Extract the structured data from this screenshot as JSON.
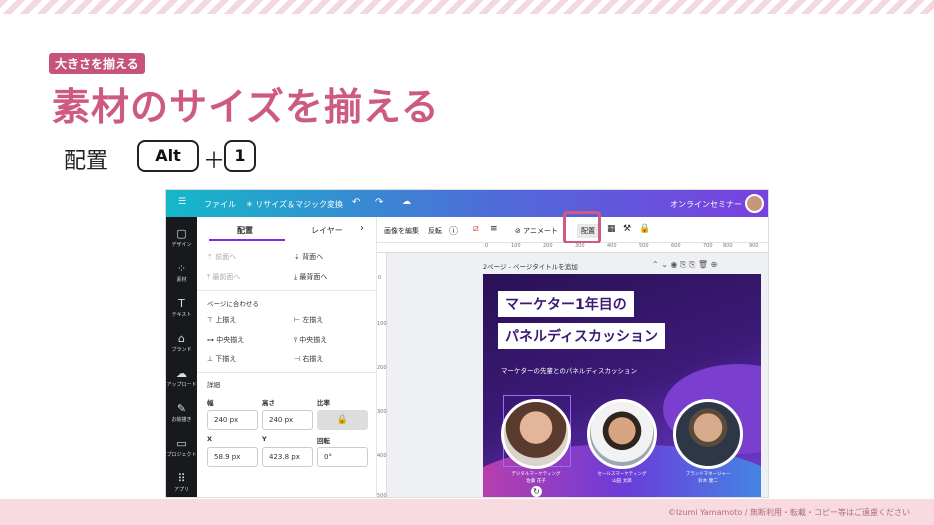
{
  "header": {
    "tag": "大きさを揃える",
    "title": "素材のサイズを揃える",
    "shortcut_label": "配置",
    "key1": "Alt",
    "plus": "＋",
    "key2": "1"
  },
  "footer": {
    "copyright": "©Izumi Yamamoto / 無断利用・転載・コピー等はご遠慮ください"
  },
  "app": {
    "topbar": {
      "menu_icon": "☰",
      "file": "ファイル",
      "resize": "✳ リサイズ＆マジック変換",
      "project_name": "オンラインセミナー"
    },
    "sidebar": [
      {
        "icon": "▢",
        "label": "デザイン"
      },
      {
        "icon": "⁘",
        "label": "素材"
      },
      {
        "icon": "T",
        "label": "テキスト"
      },
      {
        "icon": "⌂",
        "label": "ブランド"
      },
      {
        "icon": "☁",
        "label": "アップロード"
      },
      {
        "icon": "✎",
        "label": "お絵描き"
      },
      {
        "icon": "▭",
        "label": "プロジェクト"
      },
      {
        "icon": "⠿",
        "label": "アプリ"
      }
    ],
    "panel": {
      "tab_arrange": "配置",
      "tab_layer": "レイヤー",
      "tab_next": "›",
      "order": {
        "forward": "前面へ",
        "backward": "背面へ",
        "front": "最前面へ",
        "back": "最背面へ"
      },
      "align_title": "ページに合わせる",
      "align": {
        "top": "上揃え",
        "left": "左揃え",
        "middle": "中央揃え",
        "center": "中央揃え",
        "bottom": "下揃え",
        "right": "右揃え"
      },
      "detail_title": "詳細",
      "width_label": "幅",
      "height_label": "高さ",
      "ratio_label": "比率",
      "width": "240 px",
      "height": "240 px",
      "lock_icon": "🔒",
      "x_label": "X",
      "y_label": "Y",
      "rot_label": "回転",
      "x": "58.9 px",
      "y": "423.8 px",
      "rotation": "0°"
    },
    "toolbar": {
      "edit_image": "画像を編集",
      "flip": "反転",
      "animate": "アニメート",
      "arrange": "配置"
    },
    "ruler": [
      "0",
      "100",
      "200",
      "300",
      "400",
      "500",
      "600",
      "700",
      "800",
      "900"
    ],
    "vruler": [
      "0",
      "100",
      "200",
      "300",
      "400",
      "500"
    ],
    "page_label": "2ページ - ページタイトルを追加",
    "slide": {
      "heading1": "マーケター1年目の",
      "heading2": "パネルディスカッション",
      "subtitle": "マーケターの先輩とのパネルディスカッション",
      "people": [
        {
          "role": "デジタルマーケティング",
          "name": "佐藤 花子"
        },
        {
          "role": "セールスマーケティング",
          "name": "山田 太郎"
        },
        {
          "role": "ブランドマネージャー",
          "name": "鈴木 健二"
        }
      ]
    }
  }
}
